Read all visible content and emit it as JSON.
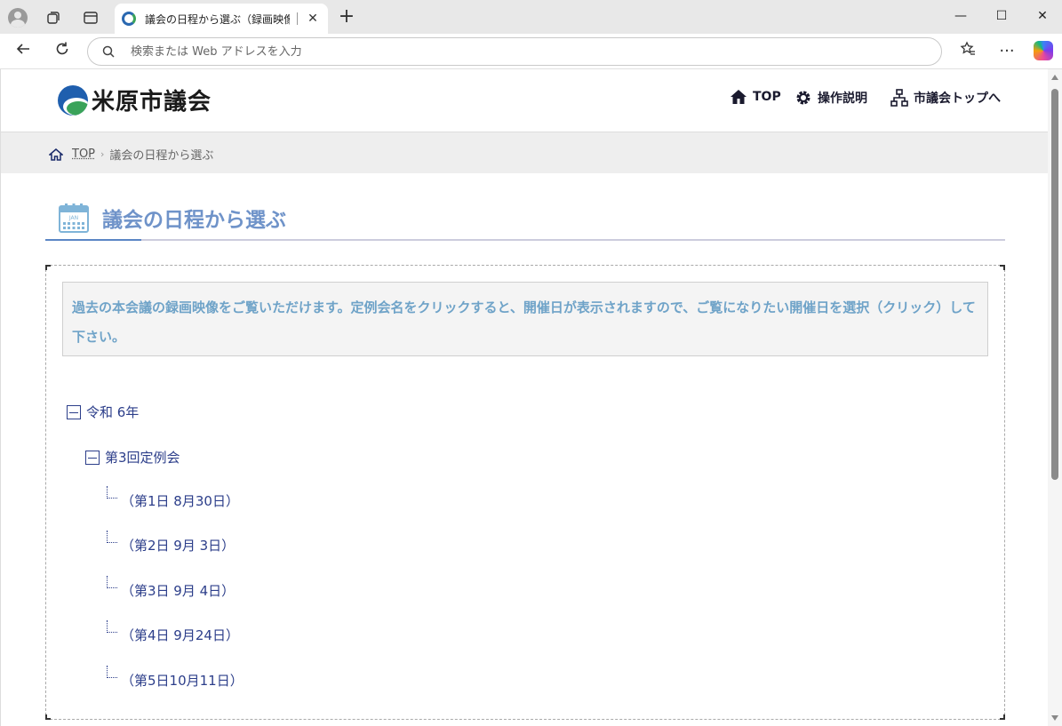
{
  "browser": {
    "tab_title": "議会の日程から選ぶ（録画映像）",
    "address_placeholder": "検索または Web アドレスを入力",
    "icons": [
      "profile-icon",
      "collections-icon",
      "tab-actions-icon",
      "new-tab-icon",
      "back-icon",
      "refresh-icon",
      "search-icon",
      "favorites-icon",
      "more-icon",
      "copilot-icon"
    ]
  },
  "site": {
    "logo_text": "米原市議会",
    "nav": {
      "top": "TOP",
      "help": "操作説明",
      "council_top": "市議会トップへ"
    }
  },
  "breadcrumb": {
    "top": "TOP",
    "separator": "›",
    "current": "議会の日程から選ぶ"
  },
  "page": {
    "title": "議会の日程から選ぶ",
    "calendar_label": "JAN",
    "notice": "過去の本会議の録画映像をご覧いただけます。定例会名をクリックすると、開催日が表示されますので、ご覧になりたい開催日を選択（クリック）して下さい。"
  },
  "tree": {
    "year": "令和 6年",
    "session": "第3回定例会",
    "days": [
      "（第1日 8月30日）",
      "（第2日 9月 3日）",
      "（第3日 9月 4日）",
      "（第4日 9月24日）",
      "（第5日10月11日）"
    ]
  },
  "colors": {
    "accent": "#6f93c9",
    "link": "#2c3e8a",
    "notice_text": "#6fa3c8"
  }
}
